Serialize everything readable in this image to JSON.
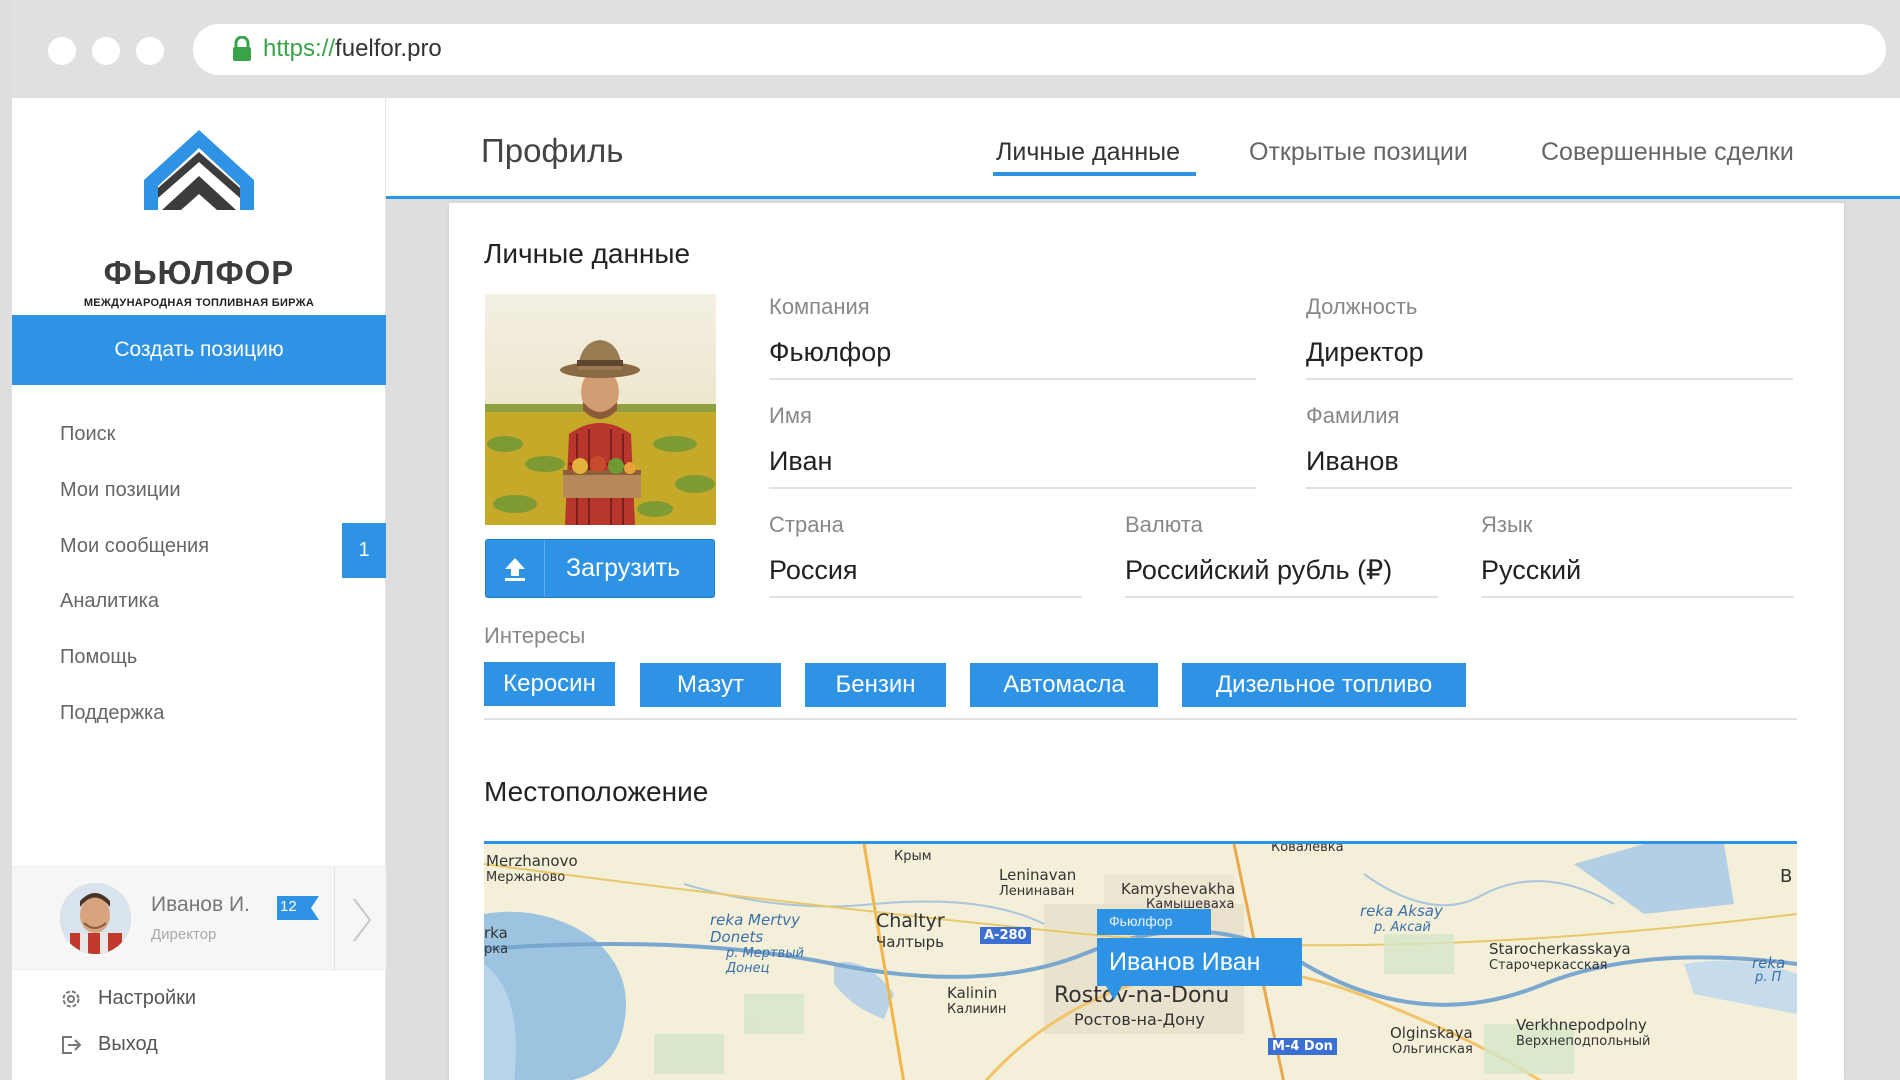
{
  "browser": {
    "url_protocol": "https://",
    "url_host": "fuelfor.pro"
  },
  "colors": {
    "accent": "#2f93e5",
    "secure_green": "#3aa34a"
  },
  "sidebar": {
    "logo_title": "ФЬЮЛФОР",
    "logo_subtitle": "МЕЖДУНАРОДНАЯ ТОПЛИВНАЯ БИРЖА",
    "create_button": "Создать позицию",
    "items": [
      {
        "label": "Поиск"
      },
      {
        "label": "Мои позиции"
      },
      {
        "label": "Мои сообщения",
        "badge": "1"
      },
      {
        "label": "Аналитика"
      },
      {
        "label": "Помощь"
      },
      {
        "label": "Поддержка"
      }
    ],
    "user": {
      "name": "Иванов И.",
      "role": "Директор",
      "badge": "12"
    },
    "settings_label": "Настройки",
    "logout_label": "Выход"
  },
  "header": {
    "title": "Профиль",
    "tabs": [
      {
        "label": "Личные данные",
        "active": true
      },
      {
        "label": "Открытые позиции",
        "active": false
      },
      {
        "label": "Совершенные сделки",
        "active": false
      }
    ]
  },
  "profile": {
    "section_title": "Личные данные",
    "upload_label": "Загрузить",
    "fields": {
      "company": {
        "label": "Компания",
        "value": "Фьюлфор"
      },
      "position": {
        "label": "Должность",
        "value": "Директор"
      },
      "first_name": {
        "label": "Имя",
        "value": "Иван"
      },
      "last_name": {
        "label": "Фамилия",
        "value": "Иванов"
      },
      "country": {
        "label": "Страна",
        "value": "Россия"
      },
      "currency": {
        "label": "Валюта",
        "value": "Российский рубль (₽)"
      },
      "language": {
        "label": "Язык",
        "value": "Русский"
      }
    },
    "interests_label": "Интересы",
    "interests": [
      "Керосин",
      "Мазут",
      "Бензин",
      "Автомасла",
      "Дизельное топливо"
    ]
  },
  "location": {
    "section_title": "Местоположение",
    "marker_company": "Фьюлфор",
    "marker_name": "Иванов Иван",
    "map_labels": {
      "merzhanovo": "Merzhanovo",
      "merzhanovo_ru": "Мержаново",
      "krym_ru": "Крым",
      "leninavan": "Leninavan",
      "leninavan_ru": "Ленинаван",
      "kamyshevakha": "Kamyshevakha",
      "kamyshevakha_ru": "Камышеваха",
      "chaltyr": "Chaltyr",
      "chaltyr_ru": "Чалтырь",
      "mertvy_donets": "reka Mertvy Donets",
      "mertvy_donets_ru": "р. Мертвый Донец",
      "rka": "rka",
      "rka_ru": "рка",
      "kalinin": "Kalinin",
      "kalinin_ru": "Калинин",
      "rostov": "Rostov-na-Donu",
      "rostov_ru": "Ростов-на-Дону",
      "aksay": "reka Aksay",
      "aksay_ru": "р. Аксай",
      "starocherkasskaya": "Starocherkasskaya",
      "starocherkasskaya_ru": "Старочеркасская",
      "olginskaya": "Olginskaya",
      "olginskaya_ru": "Ольгинская",
      "verkhnepodpolny": "Verkhnepodpolny",
      "verkhnepodpolny_ru": "Верхнеподпольный",
      "koval": "Ковалевка",
      "road_a280": "A-280",
      "road_m4": "M-4 Don",
      "edge_b": "B",
      "edge_reka": "reka",
      "edge_rp": "р. П"
    }
  }
}
